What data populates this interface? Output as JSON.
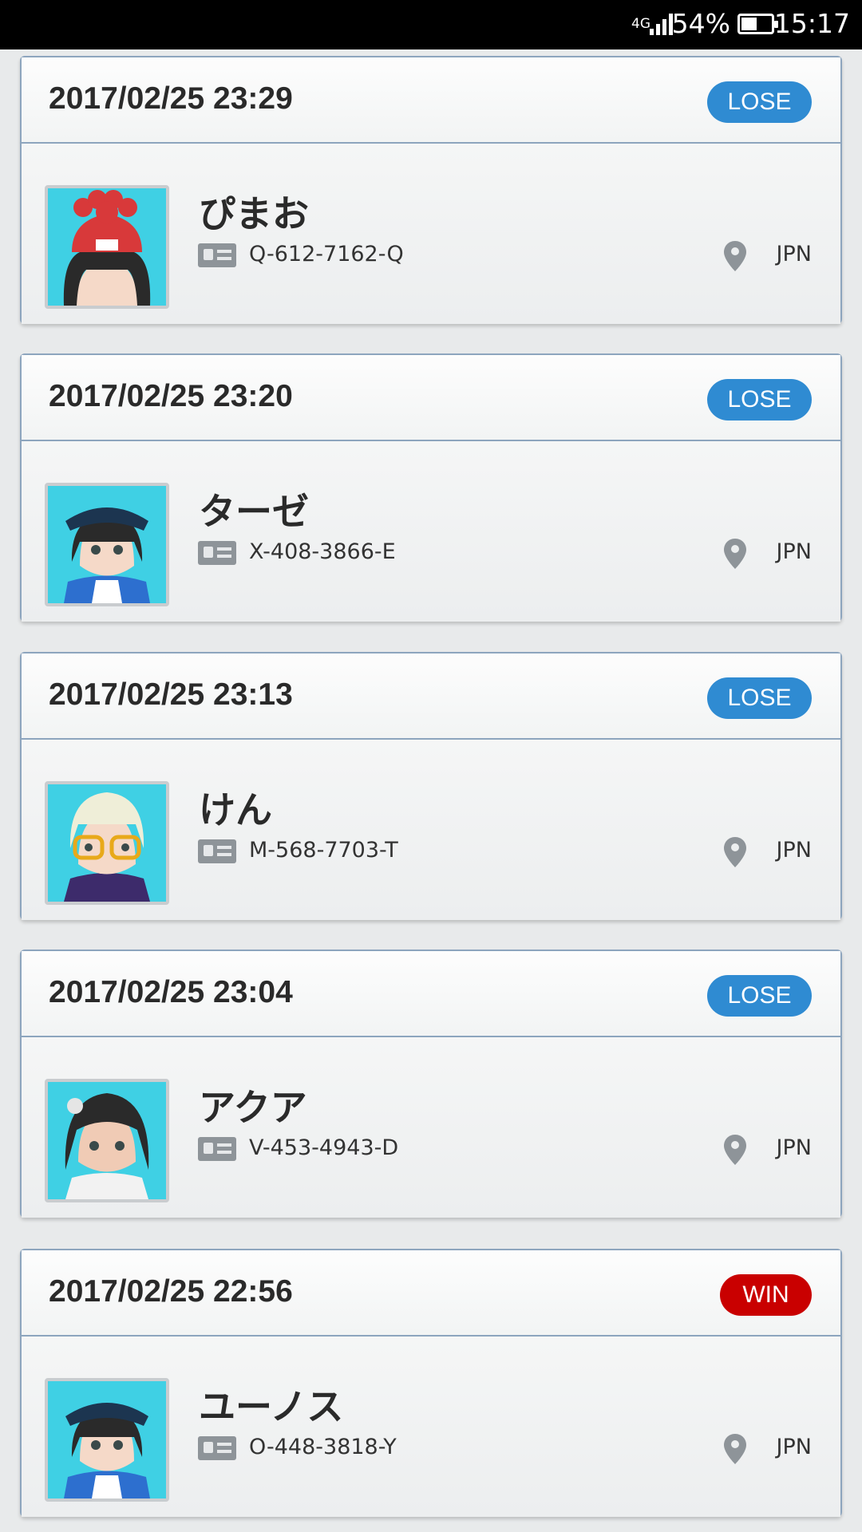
{
  "status_bar": {
    "network": "4G",
    "battery": "54%",
    "battery_level": 0.54,
    "time": "15:17"
  },
  "battles": [
    {
      "datetime": "2017/02/25 23:29",
      "result": "LOSE",
      "name": "ぴまお",
      "trainer_id": "Q-612-7162-Q",
      "country": "JPN",
      "avatar": "red-beanie-girl"
    },
    {
      "datetime": "2017/02/25 23:20",
      "result": "LOSE",
      "name": "ターゼ",
      "trainer_id": "X-408-3866-E",
      "country": "JPN",
      "avatar": "cap-boy"
    },
    {
      "datetime": "2017/02/25 23:13",
      "result": "LOSE",
      "name": "けん",
      "trainer_id": "M-568-7703-T",
      "country": "JPN",
      "avatar": "blond-glasses-boy"
    },
    {
      "datetime": "2017/02/25 23:04",
      "result": "LOSE",
      "name": "アクア",
      "trainer_id": "V-453-4943-D",
      "country": "JPN",
      "avatar": "dark-hair-girl"
    },
    {
      "datetime": "2017/02/25 22:56",
      "result": "WIN",
      "name": "ユーノス",
      "trainer_id": "O-448-3818-Y",
      "country": "JPN",
      "avatar": "cap-boy"
    }
  ],
  "colors": {
    "lose_badge": "#2f8bd2",
    "win_badge": "#c90000",
    "card_border": "#8da5be"
  }
}
